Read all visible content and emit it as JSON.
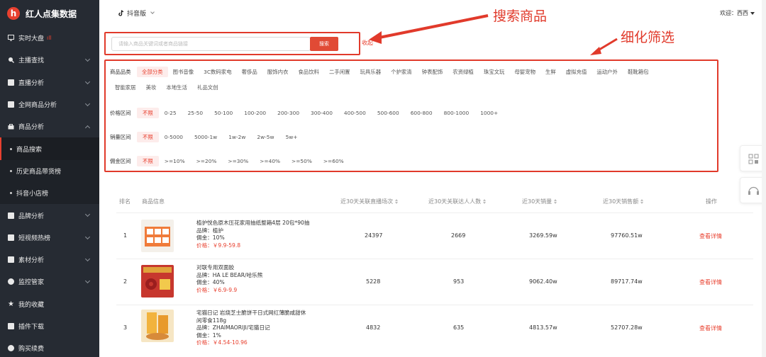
{
  "app": {
    "logo_letter": "h",
    "name": "红人点集数据"
  },
  "sidebar": {
    "items": [
      {
        "label": "实时大盘",
        "badge": "ıll",
        "icon": "monitor-icon"
      },
      {
        "label": "主播查找",
        "icon": "search-icon"
      },
      {
        "label": "直播分析",
        "icon": "chart-icon"
      },
      {
        "label": "全网商品分析",
        "icon": "chart-icon"
      },
      {
        "label": "商品分析",
        "icon": "bag-icon"
      },
      {
        "label": "商品搜索",
        "sub": true,
        "active": true
      },
      {
        "label": "历史商品带货榜",
        "sub": true
      },
      {
        "label": "抖音小店榜",
        "sub": true
      },
      {
        "label": "品牌分析",
        "icon": "grid-icon"
      },
      {
        "label": "短视频热榜",
        "icon": "video-icon"
      },
      {
        "label": "素材分析",
        "icon": "image-icon"
      },
      {
        "label": "监控管家",
        "icon": "monitor-eye-icon"
      },
      {
        "label": "我的收藏",
        "icon": "star-icon"
      },
      {
        "label": "插件下载",
        "icon": "puzzle-icon"
      },
      {
        "label": "购买续费",
        "icon": "cart-icon"
      }
    ]
  },
  "topbar": {
    "platform": "抖音版",
    "welcome": "欢迎：西西"
  },
  "search": {
    "placeholder": "请输入商品关键词或者商品链接",
    "button": "搜索",
    "collapse": "收起"
  },
  "annotations": {
    "search": "搜索商品",
    "filter": "细化筛选"
  },
  "filters": {
    "category": {
      "label": "商品品类",
      "options_line1": [
        "全部分类",
        "图书音像",
        "3C数码家电",
        "奢侈品",
        "服饰内衣",
        "食品饮料",
        "二手闲置",
        "玩具乐器",
        "个护家清",
        "钟表配饰",
        "农资绿植",
        "珠宝文玩",
        "母婴宠物",
        "生鲜",
        "虚拟充值",
        "运动户外",
        "鞋靴箱包"
      ],
      "options_line2": [
        "智能家居",
        "美妆",
        "本地生活",
        "礼品文创"
      ]
    },
    "price": {
      "label": "价格区间",
      "options": [
        "不限",
        "0-25",
        "25-50",
        "50-100",
        "100-200",
        "200-300",
        "300-400",
        "400-500",
        "500-600",
        "600-800",
        "800-1000",
        "1000+"
      ]
    },
    "sales": {
      "label": "销量区间",
      "options": [
        "不限",
        "0-5000",
        "5000-1w",
        "1w-2w",
        "2w-5w",
        "5w+"
      ]
    },
    "commission": {
      "label": "佣金区间",
      "options": [
        "不限",
        ">=10%",
        ">=20%",
        ">=30%",
        ">=40%",
        ">=50%",
        ">=60%"
      ]
    }
  },
  "table": {
    "headers": {
      "rank": "排名",
      "info": "商品信息",
      "live": "近30天关联直播场次",
      "talent": "近30天关联达人人数",
      "sales": "近30天销量",
      "revenue": "近30天销售额",
      "op": "操作"
    },
    "rows": [
      {
        "rank": "1",
        "title": "植护悦色原木压花家用抽纸整箱4层 20包*90抽",
        "brand": "品牌：植护",
        "commission": "佣金：10%",
        "price": "价格：￥9.9-59.8",
        "live": "24397",
        "talent": "2669",
        "sales": "3269.59w",
        "revenue": "97760.51w",
        "action": "查看详情"
      },
      {
        "rank": "2",
        "title": "对联专用双面胶",
        "brand": "品牌：HA LE BEAR/哈乐熊",
        "commission": "佣金：40%",
        "price": "价格：￥6.9-9.9",
        "live": "5228",
        "talent": "953",
        "sales": "9062.40w",
        "revenue": "89717.74w",
        "action": "查看详情"
      },
      {
        "rank": "3",
        "title": "宅猫日记 岩烧芝士脆饼干日式网红薄脆咸甜休",
        "title2": "闲零食118g",
        "brand": "品牌：ZHAIMAORIJI/宅猫日记",
        "commission": "佣金：1%",
        "price": "价格：￥4.54-10.96",
        "live": "4832",
        "talent": "635",
        "sales": "4813.57w",
        "revenue": "52707.28w",
        "action": "查看详情"
      }
    ]
  },
  "colors": {
    "accent": "#e8402f",
    "sidebar": "#262b33",
    "highlight_box": "#e13a2b"
  }
}
